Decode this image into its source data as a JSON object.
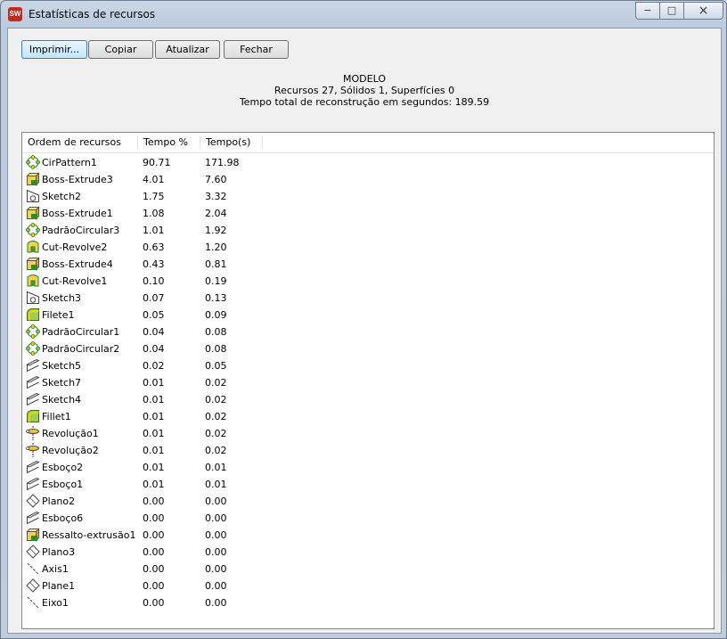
{
  "window": {
    "title": "Estatísticas de recursos",
    "app_icon": "SW"
  },
  "controls": {
    "minimize": "−",
    "maximize": "□",
    "close": "×"
  },
  "toolbar": {
    "print_label": "Imprimir...",
    "copy_label": "Copiar",
    "refresh_label": "Atualizar",
    "close_label": "Fechar"
  },
  "summary": {
    "model": "MODELO",
    "counts": "Recursos 27, Sólidos 1, Superfícies 0",
    "rebuild_time": "Tempo total de reconstrução em segundos: 189.59"
  },
  "table": {
    "columns": [
      "Ordem de recursos",
      "Tempo %",
      "Tempo(s)"
    ],
    "rows": [
      {
        "icon": "circular-pattern-icon",
        "name": "CirPattern1",
        "pct": "90.71",
        "sec": "171.98"
      },
      {
        "icon": "boss-extrude-icon",
        "name": "Boss-Extrude3",
        "pct": "4.01",
        "sec": "7.60"
      },
      {
        "icon": "sketch-icon",
        "name": "Sketch2",
        "pct": "1.75",
        "sec": "3.32"
      },
      {
        "icon": "boss-extrude-icon",
        "name": "Boss-Extrude1",
        "pct": "1.08",
        "sec": "2.04"
      },
      {
        "icon": "circular-pattern-icon",
        "name": "PadrãoCircular3",
        "pct": "1.01",
        "sec": "1.92"
      },
      {
        "icon": "cut-revolve-icon",
        "name": "Cut-Revolve2",
        "pct": "0.63",
        "sec": "1.20"
      },
      {
        "icon": "boss-extrude-icon",
        "name": "Boss-Extrude4",
        "pct": "0.43",
        "sec": "0.81"
      },
      {
        "icon": "cut-revolve-icon",
        "name": "Cut-Revolve1",
        "pct": "0.10",
        "sec": "0.19"
      },
      {
        "icon": "sketch-icon",
        "name": "Sketch3",
        "pct": "0.07",
        "sec": "0.13"
      },
      {
        "icon": "fillet-icon",
        "name": "Filete1",
        "pct": "0.05",
        "sec": "0.09"
      },
      {
        "icon": "circular-pattern-icon",
        "name": "PadrãoCircular1",
        "pct": "0.04",
        "sec": "0.08"
      },
      {
        "icon": "circular-pattern-icon",
        "name": "PadrãoCircular2",
        "pct": "0.04",
        "sec": "0.08"
      },
      {
        "icon": "sketch-line-icon",
        "name": "Sketch5",
        "pct": "0.02",
        "sec": "0.05"
      },
      {
        "icon": "sketch-line-icon",
        "name": "Sketch7",
        "pct": "0.01",
        "sec": "0.02"
      },
      {
        "icon": "sketch-line-icon",
        "name": "Sketch4",
        "pct": "0.01",
        "sec": "0.02"
      },
      {
        "icon": "fillet-icon",
        "name": "Fillet1",
        "pct": "0.01",
        "sec": "0.02"
      },
      {
        "icon": "revolve-icon",
        "name": "Revolução1",
        "pct": "0.01",
        "sec": "0.02"
      },
      {
        "icon": "revolve-icon",
        "name": "Revolução2",
        "pct": "0.01",
        "sec": "0.02"
      },
      {
        "icon": "sketch-line-icon",
        "name": "Esboço2",
        "pct": "0.01",
        "sec": "0.01"
      },
      {
        "icon": "sketch-line-icon",
        "name": "Esboço1",
        "pct": "0.01",
        "sec": "0.01"
      },
      {
        "icon": "plane-icon",
        "name": "Plano2",
        "pct": "0.00",
        "sec": "0.00"
      },
      {
        "icon": "sketch-line-icon",
        "name": "Esboço6",
        "pct": "0.00",
        "sec": "0.00"
      },
      {
        "icon": "boss-extrude-icon",
        "name": "Ressalto-extrusão1",
        "pct": "0.00",
        "sec": "0.00"
      },
      {
        "icon": "plane-icon",
        "name": "Plano3",
        "pct": "0.00",
        "sec": "0.00"
      },
      {
        "icon": "axis-icon",
        "name": "Axis1",
        "pct": "0.00",
        "sec": "0.00"
      },
      {
        "icon": "plane-icon",
        "name": "Plane1",
        "pct": "0.00",
        "sec": "0.00"
      },
      {
        "icon": "axis-icon",
        "name": "Eixo1",
        "pct": "0.00",
        "sec": "0.00"
      }
    ]
  }
}
